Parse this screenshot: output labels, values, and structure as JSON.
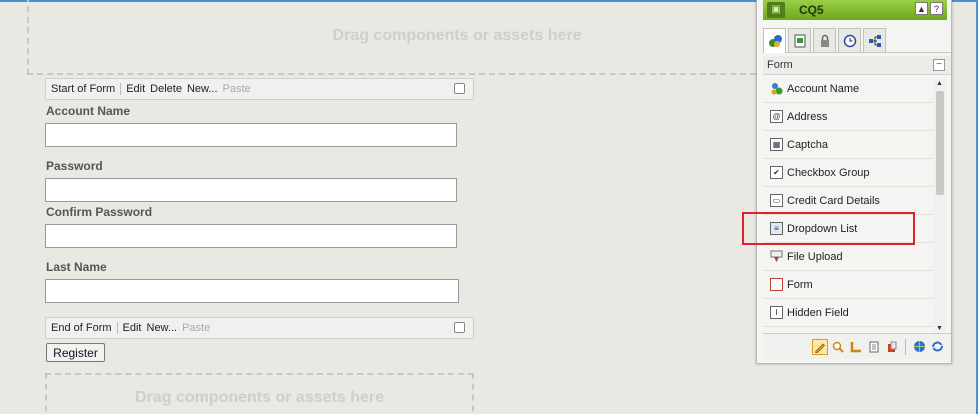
{
  "colors": {
    "accent_frame": "#4a90d9",
    "sidekick_header": "#7cb82e",
    "highlight": "#e0202a"
  },
  "canvas": {
    "drop_top": "Drag components or assets here",
    "drop_bottom": "Drag components or assets here"
  },
  "start_bar": {
    "title": "Start of Form",
    "actions": [
      "Edit",
      "Delete",
      "New..."
    ],
    "disabled": "Paste"
  },
  "end_bar": {
    "title": "End of Form",
    "actions": [
      "Edit",
      "New..."
    ],
    "disabled": "Paste"
  },
  "fields": [
    {
      "label": "Account Name",
      "value": ""
    },
    {
      "label": "Password",
      "value": ""
    },
    {
      "label": "Confirm Password",
      "value": ""
    },
    {
      "label": "Last Name",
      "value": ""
    }
  ],
  "register_label": "Register",
  "sidekick": {
    "title": "CQ5",
    "header_buttons": [
      "▲",
      "?"
    ],
    "tabs": [
      "components-icon",
      "page-icon",
      "lock-icon",
      "clock-icon",
      "workflow-icon"
    ],
    "group_label": "Form",
    "collapse": "−",
    "items": [
      {
        "label": "Account Name",
        "icon": "user-icon"
      },
      {
        "label": "Address",
        "icon": "at-icon"
      },
      {
        "label": "Captcha",
        "icon": "captcha-icon"
      },
      {
        "label": "Checkbox Group",
        "icon": "checkbox-icon"
      },
      {
        "label": "Credit Card Details",
        "icon": "card-icon"
      },
      {
        "label": "Dropdown List",
        "icon": "dropdown-icon"
      },
      {
        "label": "File Upload",
        "icon": "upload-icon"
      },
      {
        "label": "Form",
        "icon": "form-icon"
      },
      {
        "label": "Hidden Field",
        "icon": "hidden-field-icon"
      }
    ],
    "footer_buttons": [
      "pencil-icon",
      "magnifier-icon",
      "ruler-icon",
      "document-icon",
      "stack-icon",
      "globe-icon",
      "refresh-icon"
    ]
  }
}
